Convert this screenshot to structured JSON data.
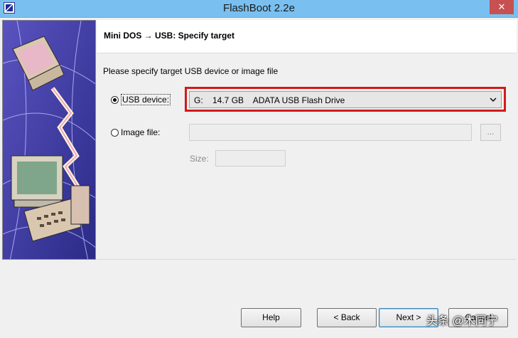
{
  "window": {
    "title": "FlashBoot 2.2e",
    "close_glyph": "✕"
  },
  "header": {
    "title": "Mini DOS → USB: Specify target"
  },
  "main": {
    "prompt": "Please specify target USB device or image file",
    "usb_option": {
      "label": "USB device:",
      "selected": true
    },
    "usb_select": {
      "value": "G:    14.7 GB    ADATA USB Flash Drive",
      "chevron": "⌄"
    },
    "image_option": {
      "label": "Image file:",
      "selected": false
    },
    "image_input": {
      "value": ""
    },
    "browse_label": "...",
    "size_label": "Size:",
    "size_value": ""
  },
  "footer": {
    "help": "Help",
    "back": "< Back",
    "next": "Next >",
    "cancel": "Cancel"
  },
  "watermark": "头条 @木同宁",
  "colors": {
    "titlebar": "#79c0f0",
    "highlight_frame": "#d21a1a",
    "close_button": "#c75050"
  }
}
